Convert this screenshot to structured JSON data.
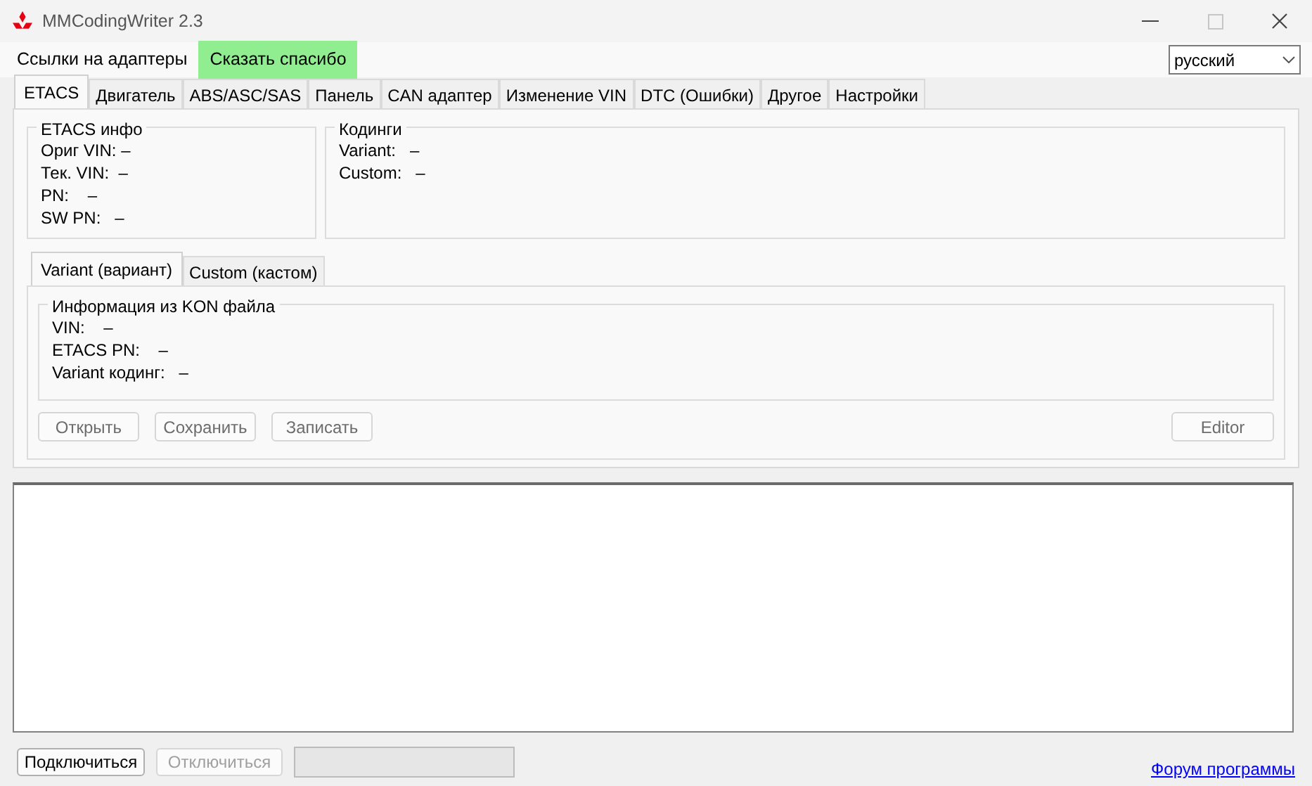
{
  "window": {
    "title": "MMCodingWriter 2.3"
  },
  "menu": [
    {
      "label": "Ссылки на адаптеры",
      "highlighted": false
    },
    {
      "label": "Сказать спасибо",
      "highlighted": true
    }
  ],
  "language": {
    "value": "русский"
  },
  "tabs": [
    {
      "label": "ETACS",
      "selected": true
    },
    {
      "label": "Двигатель",
      "selected": false
    },
    {
      "label": "ABS/ASC/SAS",
      "selected": false
    },
    {
      "label": "Панель",
      "selected": false
    },
    {
      "label": "CAN адаптер",
      "selected": false
    },
    {
      "label": "Изменение VIN",
      "selected": false
    },
    {
      "label": "DTC (Ошибки)",
      "selected": false
    },
    {
      "label": "Другое",
      "selected": false
    },
    {
      "label": "Настройки",
      "selected": false
    }
  ],
  "etacs_info": {
    "title": "ETACS инфо",
    "lines": [
      "Ориг VIN: –",
      "Тек. VIN:  –",
      "PN:    –",
      "SW PN:   –"
    ]
  },
  "codings": {
    "title": "Кодинги",
    "lines": [
      "Variant:   –",
      "Custom:   –"
    ]
  },
  "subtabs": [
    {
      "label": "Variant (вариант)",
      "selected": true
    },
    {
      "label": "Custom (кастом)",
      "selected": false
    }
  ],
  "kon_info": {
    "title": "Информация из KON файла",
    "lines": [
      "VIN:    –",
      "ETACS PN:    –",
      "Variant кодинг:   –"
    ]
  },
  "actions": [
    {
      "label": "Открыть",
      "disabled": true
    },
    {
      "label": "Сохранить",
      "disabled": true
    },
    {
      "label": "Записать",
      "disabled": true
    }
  ],
  "editor_button": {
    "label": "Editor",
    "disabled": true
  },
  "bottom": {
    "buttons": [
      {
        "label": "Подключиться",
        "disabled": false
      },
      {
        "label": "Отключиться",
        "disabled": true
      }
    ],
    "progress": {
      "level": 0
    },
    "link": "Форум программы"
  }
}
